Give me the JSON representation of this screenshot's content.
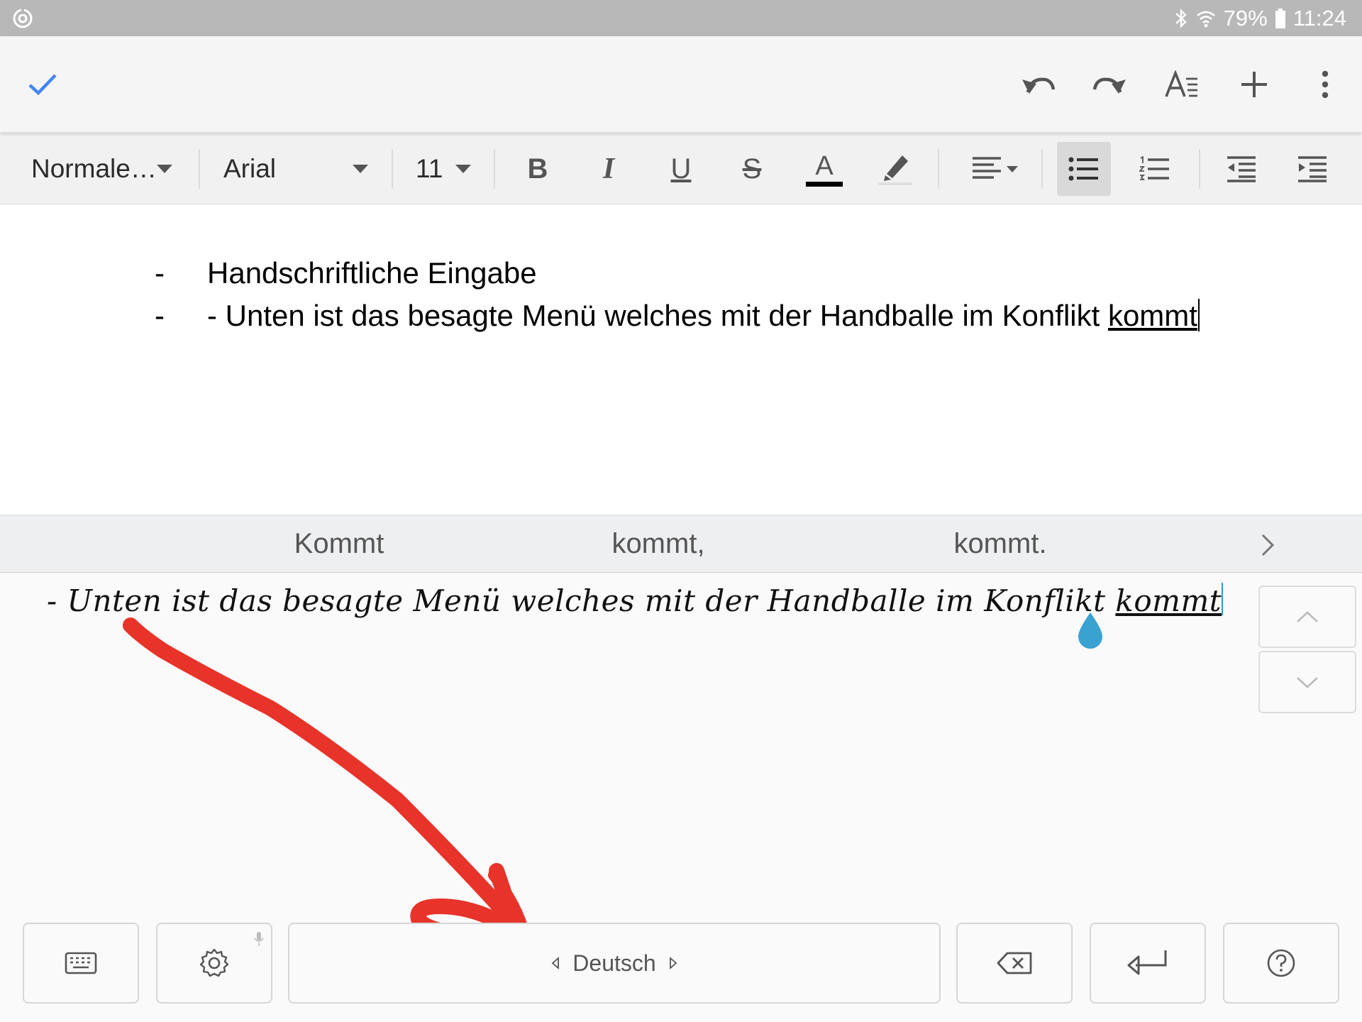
{
  "status_bar": {
    "battery_percent": "79%",
    "time": "11:24",
    "icons": [
      "sync-icon",
      "bluetooth-icon",
      "wifi-icon",
      "battery-icon"
    ]
  },
  "app_bar": {
    "icons": [
      "checkmark-icon",
      "undo-icon",
      "redo-icon",
      "text-format-icon",
      "add-icon",
      "more-vertical-icon"
    ],
    "accent_color": "#4285f4"
  },
  "toolbar": {
    "style": "Normale…",
    "font": "Arial",
    "size": "11",
    "bold_label": "B",
    "italic_label": "I",
    "underline_label": "U",
    "strike_label": "S",
    "text_color_label": "A",
    "text_color": "#000000",
    "active_button": "bulleted-list"
  },
  "document": {
    "lines": [
      {
        "bullet": "-",
        "text": "Handschriftliche Eingabe",
        "underlined": ""
      },
      {
        "bullet": "-",
        "text": "- Unten ist das besagte Menü welches mit der Handballe im Konflikt ",
        "underlined": "kommt"
      }
    ]
  },
  "suggestions": {
    "items": [
      "Kommt",
      "kommt,",
      "kommt."
    ]
  },
  "handwriting": {
    "text": "- Unten ist das besagte Menü welches mit der Handballe im Konflikt ",
    "underlined": "kommt",
    "cursor_color": "#2e9bd0",
    "annotation_color": "#e8332a"
  },
  "keyboard": {
    "language": "Deutsch"
  }
}
